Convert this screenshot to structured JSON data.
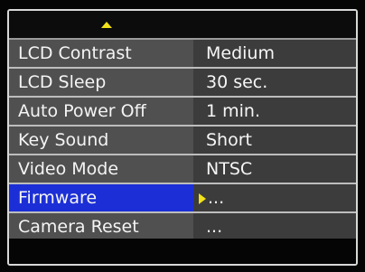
{
  "menu": {
    "items": [
      {
        "label": "LCD Contrast",
        "value": "Medium"
      },
      {
        "label": "LCD Sleep",
        "value": "30 sec."
      },
      {
        "label": "Auto Power Off",
        "value": "1 min."
      },
      {
        "label": "Key Sound",
        "value": "Short"
      },
      {
        "label": "Video Mode",
        "value": "NTSC"
      },
      {
        "label": "Firmware",
        "value": "..."
      },
      {
        "label": "Camera Reset",
        "value": "..."
      }
    ],
    "selected_index": 5
  },
  "icons": {
    "scroll_up": "scroll-up-arrow-icon",
    "selection_pointer": "selection-pointer-icon"
  },
  "colors": {
    "selected_label_bg": "#1c2fd6",
    "label_bg": "#505050",
    "value_bg": "#3c3c3c",
    "arrow": "#f3e21a",
    "separator": "#bdbdbd",
    "text": "#f4f4f4"
  }
}
